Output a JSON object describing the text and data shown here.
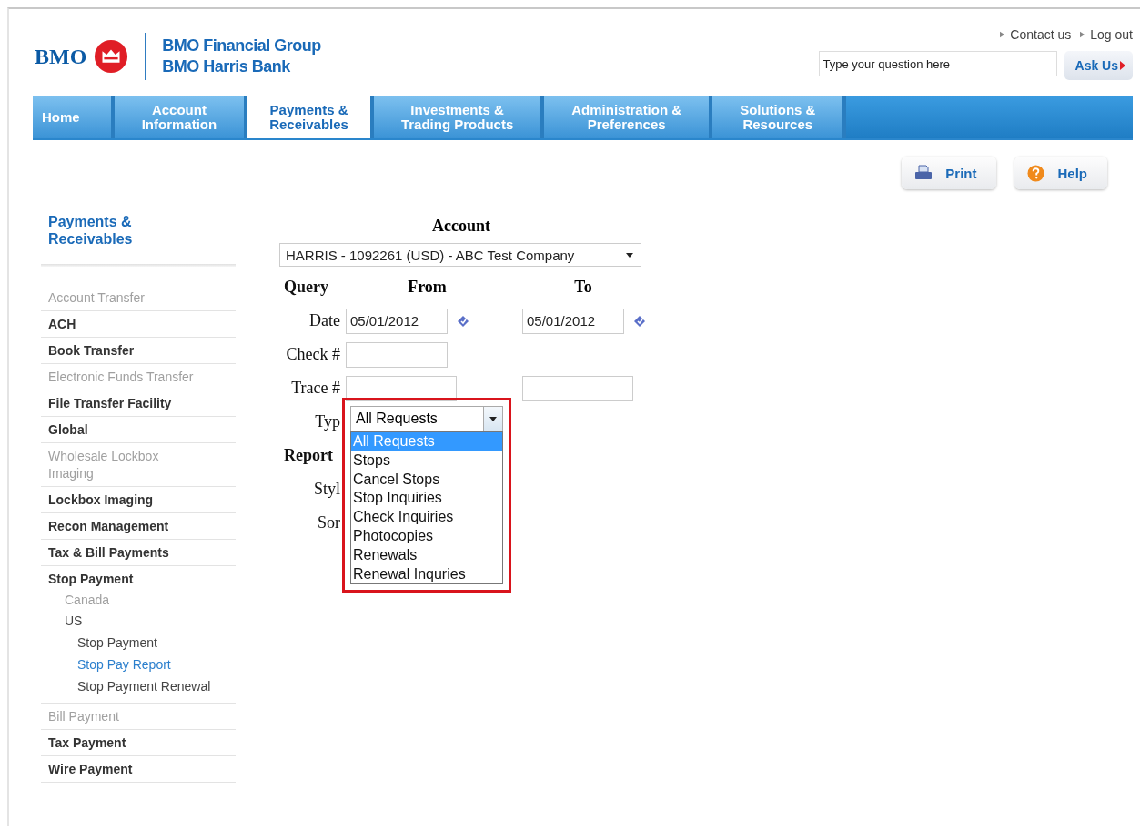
{
  "logo": {
    "wordmark": "BMO",
    "line1": "BMO Financial Group",
    "line2": "BMO Harris Bank"
  },
  "top_links": [
    "Contact us",
    "Log out"
  ],
  "search": {
    "placeholder": "Type your question here",
    "button": "Ask Us"
  },
  "nav_tabs": [
    {
      "label": "Home",
      "selected": false
    },
    {
      "label": "Account\nInformation",
      "selected": false
    },
    {
      "label": "Payments &\nReceivables",
      "selected": true
    },
    {
      "label": "Investments &\nTrading Products",
      "selected": false
    },
    {
      "label": "Administration &\nPreferences",
      "selected": false
    },
    {
      "label": "Solutions &\nResources",
      "selected": false
    }
  ],
  "actions": [
    {
      "label": "Print",
      "kind": "print"
    },
    {
      "label": "Help",
      "kind": "help"
    }
  ],
  "sidebar": {
    "title": "Payments &\nReceivables",
    "items": [
      {
        "label": "Account Transfer",
        "disabled": true
      },
      {
        "label": "ACH",
        "disabled": false
      },
      {
        "label": "Book Transfer",
        "disabled": false
      },
      {
        "label": "Electronic Funds Transfer",
        "disabled": true
      },
      {
        "label": "File Transfer Facility",
        "disabled": false
      },
      {
        "label": "Global",
        "disabled": false
      },
      {
        "label": "Wholesale Lockbox Imaging",
        "disabled": true
      },
      {
        "label": "Lockbox Imaging",
        "disabled": false
      },
      {
        "label": "Recon Management",
        "disabled": false
      },
      {
        "label": "Tax & Bill Payments",
        "disabled": false
      },
      {
        "label": "Stop Payment",
        "disabled": false,
        "children": [
          {
            "label": "Canada",
            "disabled": true
          },
          {
            "label": "US",
            "disabled": false,
            "children": [
              {
                "label": "Stop Payment",
                "selected": false
              },
              {
                "label": "Stop Pay Report",
                "selected": true
              },
              {
                "label": "Stop Payment Renewal",
                "selected": false
              }
            ]
          }
        ]
      },
      {
        "label": "Bill Payment",
        "disabled": true
      },
      {
        "label": "Tax Payment",
        "disabled": false
      },
      {
        "label": "Wire Payment",
        "disabled": false
      }
    ]
  },
  "form": {
    "account_label": "Account",
    "account_value": "HARRIS - 1092261 (USD) - ABC Test Company",
    "query_label": "Query",
    "from_label": "From",
    "to_label": "To",
    "rows": [
      {
        "label": "Date",
        "kind": "date",
        "from": "05/01/2012",
        "to": "05/01/2012"
      },
      {
        "label": "Check #",
        "kind": "single"
      },
      {
        "label": "Trace #",
        "kind": "range"
      }
    ],
    "type": {
      "label": "Typ",
      "value": "All Requests",
      "open": true,
      "highlighted": true,
      "options": [
        {
          "label": "All Requests",
          "selected": true
        },
        {
          "label": "Stops",
          "selected": false
        },
        {
          "label": "Cancel Stops",
          "selected": false
        },
        {
          "label": "Stop Inquiries",
          "selected": false
        },
        {
          "label": "Check Inquiries",
          "selected": false
        },
        {
          "label": "Photocopies",
          "selected": false
        },
        {
          "label": "Renewals",
          "selected": false
        },
        {
          "label": "Renewal Inquries",
          "selected": false
        }
      ]
    },
    "lower_labels": [
      {
        "label": "Report",
        "kind": "heading"
      },
      {
        "label": "Styl",
        "kind": "field"
      },
      {
        "label": "Sor",
        "kind": "field"
      }
    ]
  }
}
